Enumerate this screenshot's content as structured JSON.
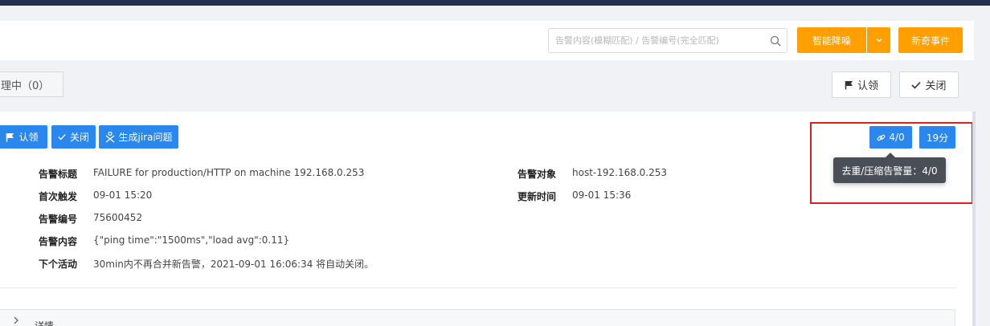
{
  "search": {
    "placeholder": "告警内容(模糊匹配) / 告警编号(完全匹配)",
    "value": ""
  },
  "toolbar": {
    "denoise_label": "智能降噪",
    "new_event_label": "新奇事件"
  },
  "tabs": {
    "processing_label": "理中（0）"
  },
  "top_actions": {
    "claim_label": "认领",
    "close_label": "关闭"
  },
  "card_actions": {
    "claim_label": "认领",
    "close_label": "关闭",
    "jira_label": "生成jira问题"
  },
  "badges": {
    "count_label": "4/0",
    "time_label": "19分"
  },
  "tooltip": {
    "text": "去重/压缩告警量：4/0"
  },
  "fields": {
    "title": {
      "label": "告警标题",
      "value": "FAILURE for production/HTTP on machine 192.168.0.253"
    },
    "first_trigger": {
      "label": "首次触发",
      "value": "09-01 15:20"
    },
    "alert_id": {
      "label": "告警编号",
      "value": "75600452"
    },
    "content": {
      "label": "告警内容",
      "value": "{\"ping time\":\"1500ms\",\"load avg\":0.11}"
    },
    "next_activity": {
      "label": "下个活动",
      "value": "30min内不再合并新告警，2021-09-01 16:06:34 将自动关闭。"
    },
    "target": {
      "label": "告警对象",
      "value": "host-192.168.0.253"
    },
    "update_time": {
      "label": "更新时间",
      "value": "09-01 15:36"
    }
  },
  "details": {
    "label": "详情"
  },
  "colors": {
    "primary": "#2a87ee",
    "accent": "#ff9f00",
    "header": "#23314f",
    "highlight": "#e02020"
  }
}
